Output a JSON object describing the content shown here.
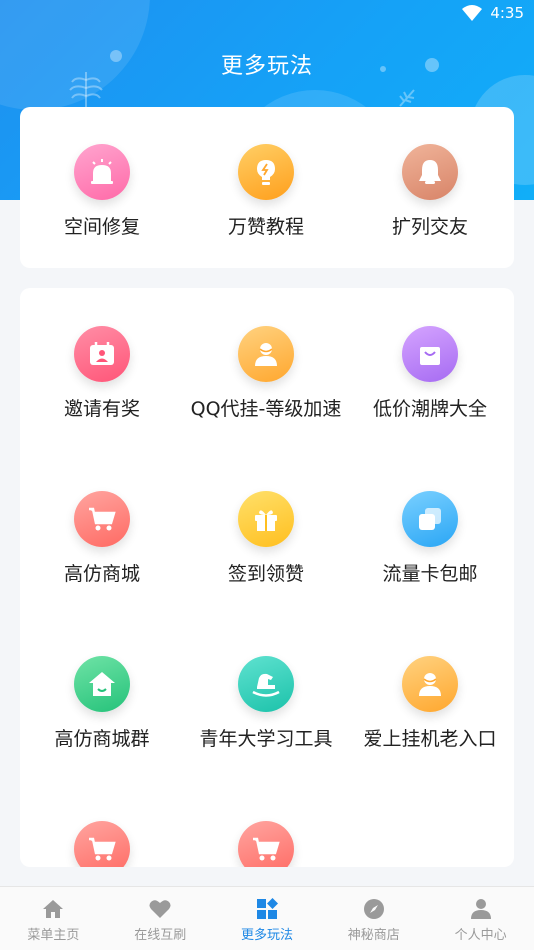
{
  "status_bar": {
    "time": "4:35"
  },
  "header": {
    "title": "更多玩法"
  },
  "top_items": [
    {
      "label": "空间修复",
      "icon": "siren-icon",
      "color_from": "#ffa5cf",
      "color_to": "#ff6aa8"
    },
    {
      "label": "万赞教程",
      "icon": "lightbulb-icon",
      "color_from": "#ffcf66",
      "color_to": "#ff9f1c"
    },
    {
      "label": "扩列交友",
      "icon": "qq-penguin-icon",
      "color_from": "#f0b49a",
      "color_to": "#d88468"
    }
  ],
  "grid_items": [
    {
      "label": "邀请有奖",
      "icon": "calendar-user-icon",
      "color_from": "#ff8ea6",
      "color_to": "#ff5578"
    },
    {
      "label": "QQ代挂-等级加速",
      "icon": "user-icon",
      "color_from": "#ffd280",
      "color_to": "#ffa72e"
    },
    {
      "label": "低价潮牌大全",
      "icon": "shopping-bag-icon",
      "color_from": "#d5a4ff",
      "color_to": "#a66bf2"
    },
    {
      "label": "高仿商城",
      "icon": "cart-icon",
      "color_from": "#ffa5a0",
      "color_to": "#ff6a63"
    },
    {
      "label": "签到领赞",
      "icon": "gift-icon",
      "color_from": "#ffe06a",
      "color_to": "#ffbf1f"
    },
    {
      "label": "流量卡包邮",
      "icon": "cards-icon",
      "color_from": "#7ad0ff",
      "color_to": "#2aa6f5"
    },
    {
      "label": "高仿商城群",
      "icon": "house-icon",
      "color_from": "#6fe3a6",
      "color_to": "#25c27a"
    },
    {
      "label": "青年大学习工具",
      "icon": "rocking-horse-icon",
      "color_from": "#5fe2d0",
      "color_to": "#1cc2aa"
    },
    {
      "label": "爱上挂机老入口",
      "icon": "user-icon",
      "color_from": "#ffd280",
      "color_to": "#ffa72e"
    },
    {
      "label": "",
      "icon": "cart-icon",
      "color_from": "#ffa5a0",
      "color_to": "#ff6a63"
    },
    {
      "label": "",
      "icon": "cart-icon",
      "color_from": "#ffa5a0",
      "color_to": "#ff6a63"
    }
  ],
  "tabs": [
    {
      "label": "菜单主页",
      "icon": "home-icon",
      "active": false
    },
    {
      "label": "在线互刷",
      "icon": "heart-icon",
      "active": false
    },
    {
      "label": "更多玩法",
      "icon": "grid-more-icon",
      "active": true
    },
    {
      "label": "神秘商店",
      "icon": "compass-icon",
      "active": false
    },
    {
      "label": "个人中心",
      "icon": "person-icon",
      "active": false
    }
  ],
  "colors": {
    "accent": "#1e88e5",
    "header": "#15a2f7"
  }
}
